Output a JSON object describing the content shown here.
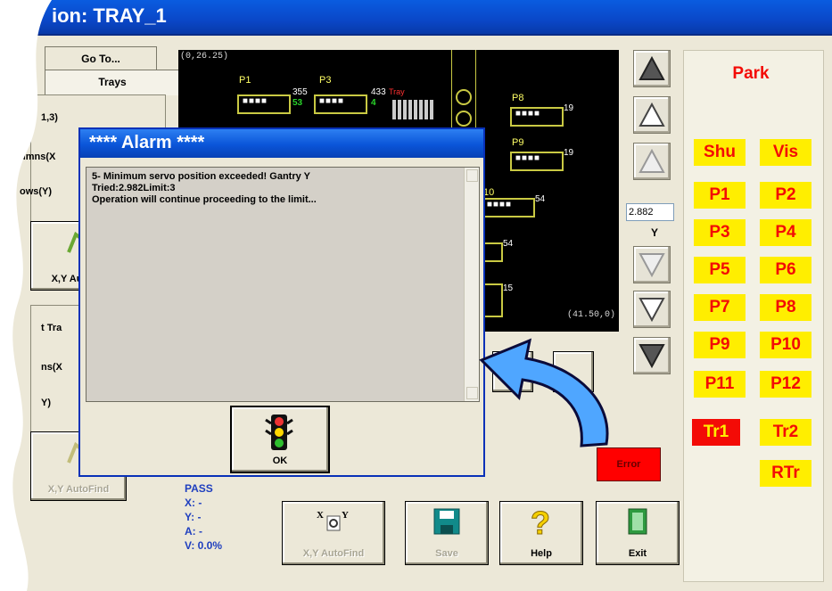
{
  "window": {
    "title": "ion: TRAY_1"
  },
  "left": {
    "tab_goto": "Go To...",
    "tab_trays": "Trays",
    "val_13": "1,3)",
    "lbl_columns": "umns(X",
    "lbl_rows": "ows(Y)",
    "btn_xy_autofind_top": "X,Y Au",
    "lbl_tray": "t Tra",
    "lbl_ns": "ns(X",
    "lbl_y": "Y)",
    "btn_xy_autofind_bottom": "X,Y AutoFind"
  },
  "view": {
    "top_left_coord": "(0,26.25)",
    "bottom_right_coord": "(41.50,0)",
    "pockets": [
      {
        "label": "P1"
      },
      {
        "label": "P3"
      },
      {
        "label": "P8"
      },
      {
        "label": "P9"
      }
    ],
    "values": {
      "n355": "355",
      "n433": "433",
      "n53": "53",
      "n4": "4",
      "n19a": "19",
      "n19b": "19",
      "n54a": "54",
      "n54b": "54",
      "n15": "15",
      "n10": "10"
    },
    "tray_label": "Tray"
  },
  "alarm": {
    "title": "**** Alarm ****",
    "line1": "5- Minimum servo position exceeded! Gantry Y",
    "line2": "Tried:2.982Limit:3",
    "line3": "Operation will continue proceeding to the limit...",
    "ok_label": "OK"
  },
  "axis": {
    "y_value": "2.882",
    "y_label": "Y"
  },
  "right_panel": {
    "park": "Park",
    "shu": "Shu",
    "vis": "Vis",
    "positions": [
      "P1",
      "P2",
      "P3",
      "P4",
      "P5",
      "P6",
      "P7",
      "P8",
      "P9",
      "P10",
      "P11",
      "P12"
    ],
    "tr1": "Tr1",
    "tr2": "Tr2",
    "rtr": "RTr"
  },
  "status": {
    "pass": "PASS",
    "x": "X: -",
    "y": "Y: -",
    "a": "A: -",
    "v": "V: 0.0%"
  },
  "bottom": {
    "xy_autofind": "X,Y AutoFind",
    "save": "Save",
    "help": "Help",
    "exit": "Exit",
    "error": "Error"
  },
  "colors": {
    "accent": "#0a47c8",
    "alarm_red": "#f30b06",
    "highlight_yellow": "#ffee00"
  }
}
